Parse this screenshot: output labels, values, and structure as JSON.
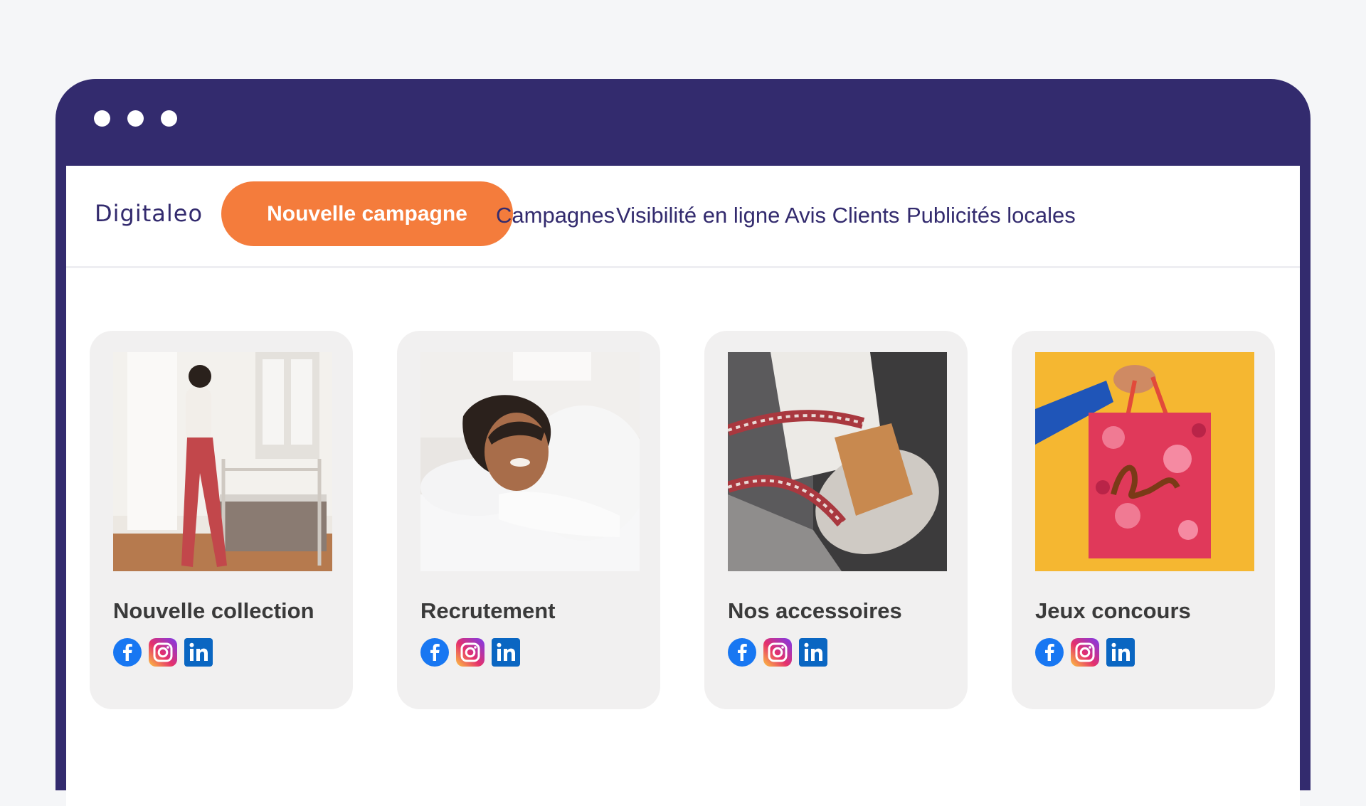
{
  "window": {
    "dots": 3
  },
  "header": {
    "logo": "Digitaleo",
    "cta_label": "Nouvelle campagne",
    "nav": [
      "Campagnes",
      "Visibilité en ligne",
      "Avis Clients",
      "Publicités locales"
    ]
  },
  "cards": [
    {
      "title": "Nouvelle collection",
      "image": "woman-in-bedroom-photo",
      "socials": [
        "facebook-icon",
        "instagram-icon",
        "linkedin-icon"
      ]
    },
    {
      "title": "Recrutement",
      "image": "smiling-woman-on-bed-photo",
      "socials": [
        "facebook-icon",
        "instagram-icon",
        "linkedin-icon"
      ]
    },
    {
      "title": "Nos accessoires",
      "image": "handbag-photo",
      "socials": [
        "facebook-icon",
        "instagram-icon",
        "linkedin-icon"
      ]
    },
    {
      "title": "Jeux concours",
      "image": "gift-bag-photo",
      "socials": [
        "facebook-icon",
        "instagram-icon",
        "linkedin-icon"
      ]
    }
  ],
  "colors": {
    "frame": "#332b6e",
    "accent": "#f47c3c",
    "nav_text": "#332b6e",
    "card_bg": "#f1f0f0"
  }
}
